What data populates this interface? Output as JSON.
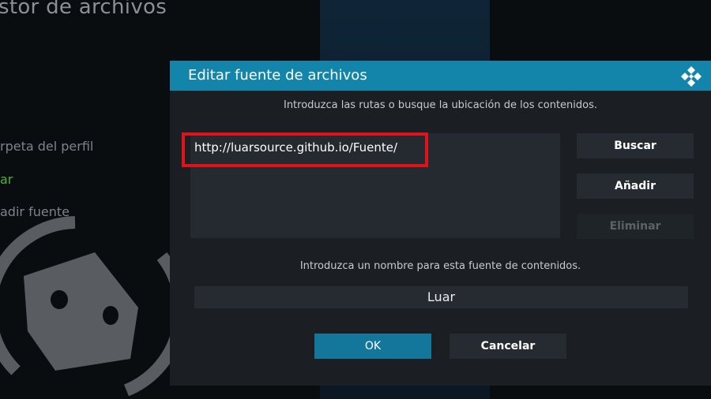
{
  "background": {
    "title": "stor de archivos",
    "items": [
      {
        "label": "rpeta del perfil"
      },
      {
        "label": "ar"
      },
      {
        "label": "adir fuente"
      }
    ]
  },
  "dialog": {
    "title": "Editar fuente de archivos",
    "paths_prompt": "Introduzca las rutas o busque la ubicación de los contenidos.",
    "path_value": "http://luarsource.github.io/Fuente/",
    "buttons": {
      "browse": "Buscar",
      "add": "Añadir",
      "remove": "Eliminar"
    },
    "name_prompt": "Introduzca un nombre para esta fuente de contenidos.",
    "name_value": "Luar",
    "ok": "OK",
    "cancel": "Cancelar"
  },
  "colors": {
    "header": "#1384aa",
    "highlight_border": "#e0131b",
    "ok_button": "#13779c"
  },
  "icons": {
    "logo": "kodi-logo-icon",
    "watermark": "robot-head-watermark-icon"
  }
}
